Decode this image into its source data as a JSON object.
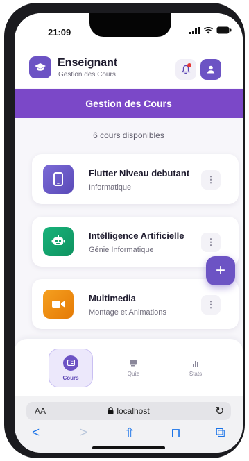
{
  "status_bar": {
    "time": "21:09"
  },
  "header": {
    "title": "Enseignant",
    "subtitle": "Gestion des Cours",
    "icons": [
      "graduation-cap-icon",
      "bell-icon",
      "user-icon"
    ]
  },
  "banner": {
    "title": "Gestion des Cours"
  },
  "course_count": "6 cours disponibles",
  "courses": [
    {
      "title": "Flutter Niveau debutant",
      "category": "Informatique",
      "icon": "phone-icon",
      "color": "#6a5ac8",
      "menu": "⋮"
    },
    {
      "title": "Intélligence Artificielle",
      "category": "Génie Informatique",
      "icon": "robot-icon",
      "color": "#12a36b",
      "menu": "⋮"
    },
    {
      "title": "Multimedia",
      "category": "Montage et Animations",
      "icon": "video-icon",
      "color": "#ee8a10",
      "menu": "⋮"
    }
  ],
  "fab": {
    "label": "+"
  },
  "bottom_nav": [
    {
      "label": "Cours",
      "icon": "course-icon",
      "active": true
    },
    {
      "label": "Quiz",
      "icon": "quiz-icon",
      "active": false
    },
    {
      "label": "Stats",
      "icon": "stats-icon",
      "active": false
    }
  ],
  "browser": {
    "aa_label": "AA",
    "url": "localhost",
    "reload_glyph": "↻",
    "tool_glyphs": {
      "back": "<",
      "forward": ">",
      "share": "⇧",
      "bookmarks": "⊓",
      "tabs": "⧉"
    }
  },
  "colors": {
    "accent": "#6c53c4",
    "banner": "#7b48c8",
    "green": "#12a36b",
    "orange": "#ee8a10"
  }
}
